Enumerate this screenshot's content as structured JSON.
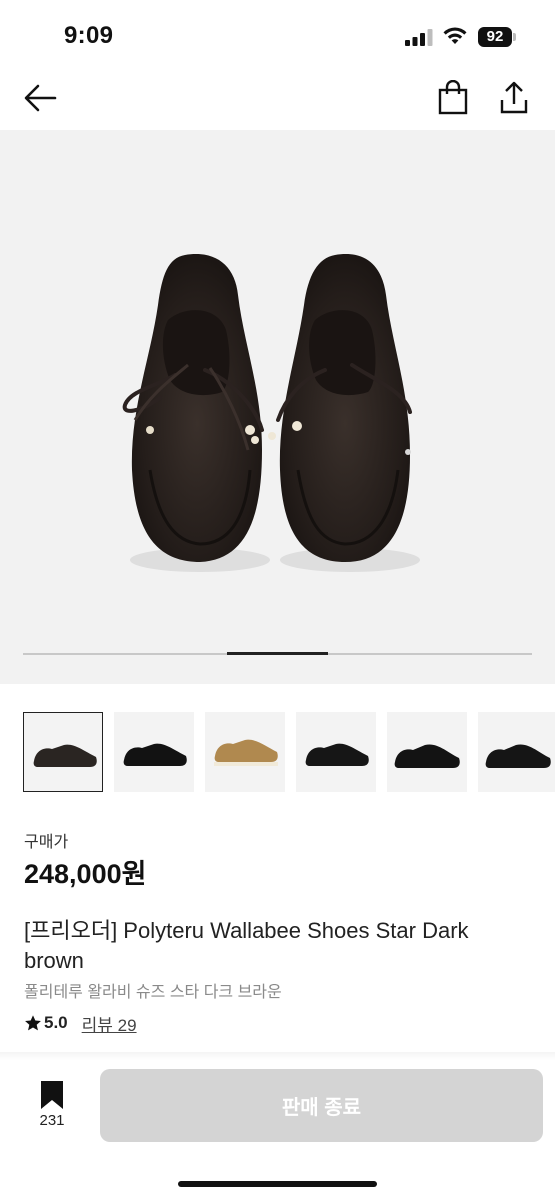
{
  "status_bar": {
    "time": "9:09",
    "battery": "92",
    "icons": [
      "signal-icon",
      "wifi-icon",
      "battery-icon"
    ]
  },
  "nav": {
    "icons": [
      "back-arrow-icon",
      "shopping-bag-icon",
      "share-icon"
    ]
  },
  "gallery": {
    "image": "dark brown suede wallabee shoes pair with beaded laces",
    "progress": {
      "current": 3,
      "total": 5
    },
    "thumbnails": [
      {
        "color": "#2a2522",
        "selected": true
      },
      {
        "color": "#121212",
        "selected": false
      },
      {
        "color": "#b0894f",
        "selected": false
      },
      {
        "color": "#161616",
        "selected": false
      },
      {
        "color": "#131313",
        "selected": false
      },
      {
        "color": "#151515",
        "selected": false
      }
    ]
  },
  "price": {
    "label": "구매가",
    "value": "248,000원"
  },
  "product": {
    "title": "[프리오더] Polyteru Wallabee Shoes Star Dark brown",
    "subtitle": "폴리테루 왈라비 슈즈 스타 다크 브라운",
    "rating": "5.0",
    "reviews": "리뷰 29"
  },
  "bottom_bar": {
    "bookmark_count": "231",
    "button_label": "판매 종료"
  },
  "colors": {
    "button_disabled": "#d4d4d4",
    "hero_bg": "#f2f2f2",
    "subtitle": "#8a8a8a"
  }
}
